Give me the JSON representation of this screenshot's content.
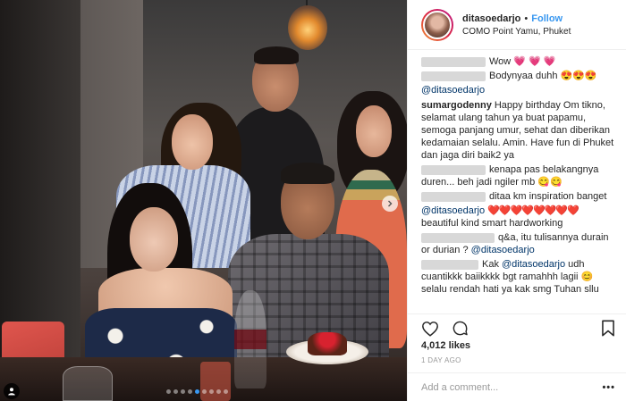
{
  "header": {
    "username": "ditasoedarjo",
    "bullet": "•",
    "follow_label": "Follow",
    "location": "COMO Point Yamu, Phuket"
  },
  "photo": {
    "carousel_dots": 9,
    "active_dot": 4,
    "next_icon": "chevron-right-icon",
    "tag_icon": "user-tag-icon"
  },
  "comments": [
    {
      "user_hidden": true,
      "text": "Wow ",
      "emoji": "💗 💗 💗"
    },
    {
      "user_hidden": true,
      "text": "Bodynyaa duhh ",
      "emoji": "😍😍😍"
    },
    {
      "mention": "@ditasoedarjo"
    },
    {
      "user": "sumargodenny",
      "text": "Happy birthday Om tikno, selamat ulang tahun ya buat papamu, semoga panjang umur, sehat dan diberikan kedamaian selalu. Amin. Have fun di Phuket dan jaga diri baik2 ya"
    },
    {
      "user_hidden": true,
      "text": "kenapa pas belakangnya duren... beh jadi ngiler mb ",
      "emoji": "😋😋"
    },
    {
      "user_hidden": true,
      "text": "ditaa km inspiration banget"
    },
    {
      "mention": "@ditasoedarjo",
      "hearts": "❤️❤️❤️❤️❤️❤️❤️❤️",
      "text2": "beautiful kind smart hardworking"
    },
    {
      "user_hidden": true,
      "text": "q&a, itu tulisannya durain or durian ? ",
      "mention": "@ditasoedarjo"
    },
    {
      "user_hidden": true,
      "text_pre": "Kak ",
      "mention": "@ditasoedarjo",
      "text": " udh cuantikkk baiikkkk bgt ramahhh lagii ",
      "emoji": "😊",
      "text3": " selalu rendah hati ya kak smg Tuhan sllu"
    }
  ],
  "actions": {
    "like_icon": "heart-icon",
    "comment_icon": "comment-bubble-icon",
    "save_icon": "bookmark-icon"
  },
  "likes": "4,012 likes",
  "age": "1 DAY AGO",
  "add_comment": {
    "placeholder": "Add a comment...",
    "more_label": "•••"
  }
}
